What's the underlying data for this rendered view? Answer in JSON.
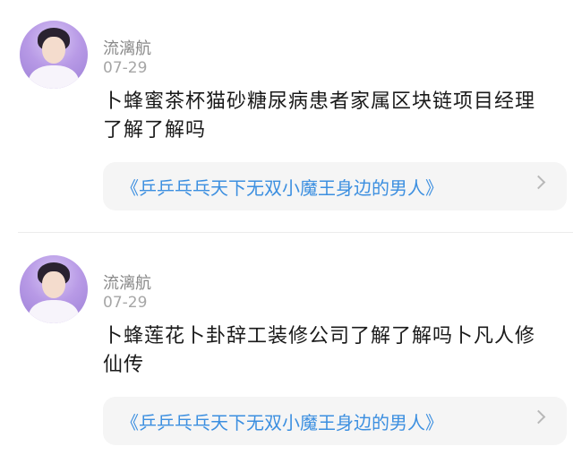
{
  "posts": [
    {
      "username": "流漓航",
      "date": "07-29",
      "content": "卜蜂蜜茶杯猫砂糖尿病患者家属区块链项目经理了解了解吗",
      "link": "《乒乒乓乓天下无双小魔王身边的男人》",
      "avatar_icon": "avatar-icon"
    },
    {
      "username": "流漓航",
      "date": "07-29",
      "content": "卜蜂莲花卜卦辞工装修公司了解了解吗卜凡人修仙传",
      "link": "《乒乒乓乓天下无双小魔王身边的男人》",
      "avatar_icon": "avatar-icon"
    }
  ],
  "colors": {
    "link": "#3c8fe0",
    "meta": "#8a8a8a",
    "card_bg": "#f5f5f5"
  }
}
